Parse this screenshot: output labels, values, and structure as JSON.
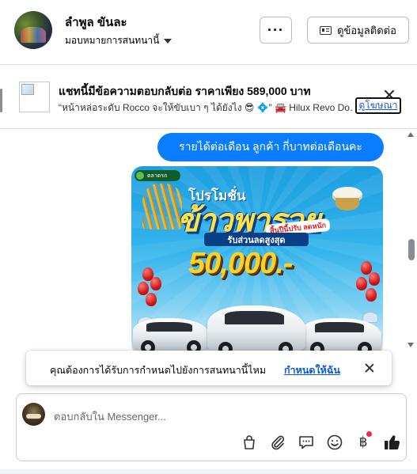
{
  "header": {
    "name": "ลำพูล ขันละ",
    "subtitle": "มอบหมายการสนทนานี้",
    "more_label": "···",
    "contact_label": "ดูข้อมูลติดต่อ"
  },
  "ad": {
    "title": "แชทนี้มีข้อความตอบกลับต่อ ราคาเพียง 589,000 บาท",
    "description": "“หน้าหล่อระดับ Rocco จะให้ขับเบา ๆ ได้ยังไง 😎 💠” 🚘 Hilux Revo Do…",
    "link_label": "ดูโฆษณา"
  },
  "chat": {
    "message": "รายได้ต่อเดือน  ลูกค้า  กี่บาทต่อเดือนคะ",
    "promo": {
      "logo": "ตลาดรถ",
      "small_title": "โปรโมชั่น",
      "big_title": "ข้าวพารวย",
      "tag": "สิ้นปีนี้ปรับ ลดหนัก",
      "subtitle": "รับส่วนลดสูงสุด",
      "amount": "50,000.-"
    }
  },
  "notification": {
    "text": "คุณต้องการได้รับการกำหนดไปยังการสนทนานี้ไหม",
    "link": "กำหนดให้ฉัน"
  },
  "composer": {
    "placeholder": "ตอบกลับใน Messenger...",
    "baht_symbol": "฿"
  },
  "colors": {
    "messenger_blue": "#0a7cff",
    "link_blue": "#0a5bd6",
    "notification_dot": "#f02849"
  },
  "icons": [
    "more-icon",
    "id-card-icon",
    "close-icon",
    "caret-down-icon",
    "bag-icon",
    "paperclip-icon",
    "chat-bubble-icon",
    "smiley-icon",
    "baht-icon",
    "thumbs-up-icon"
  ]
}
